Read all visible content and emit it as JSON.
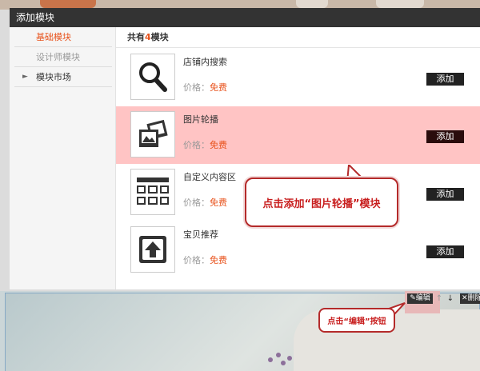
{
  "modal": {
    "title": "添加模块"
  },
  "sidebar": {
    "items": [
      {
        "label": "基础模块"
      },
      {
        "label": "设计师模块"
      },
      {
        "label": "模块市场"
      }
    ]
  },
  "content": {
    "header_prefix": "共有",
    "header_count": "4",
    "header_suffix": "模块",
    "modules": [
      {
        "title": "店铺内搜索",
        "price_label": "价格：",
        "price": "免费",
        "add_label": "添加"
      },
      {
        "title": "图片轮播",
        "price_label": "价格：",
        "price": "免费",
        "add_label": "添加"
      },
      {
        "title": "自定义内容区",
        "price_label": "价格：",
        "price": "免费",
        "add_label": "添加"
      },
      {
        "title": "宝贝推荐",
        "price_label": "价格：",
        "price": "免费",
        "add_label": "添加"
      }
    ]
  },
  "callouts": {
    "add_slider": "点击添加“图片轮播”模块",
    "edit_button": "点击“编辑”按钮"
  },
  "toolbar": {
    "edit_label": "编辑",
    "delete_label": "删除"
  },
  "colors": {
    "accent": "#e8531d",
    "highlight": "#ffc4c4",
    "callout_border": "#b42a2a"
  }
}
